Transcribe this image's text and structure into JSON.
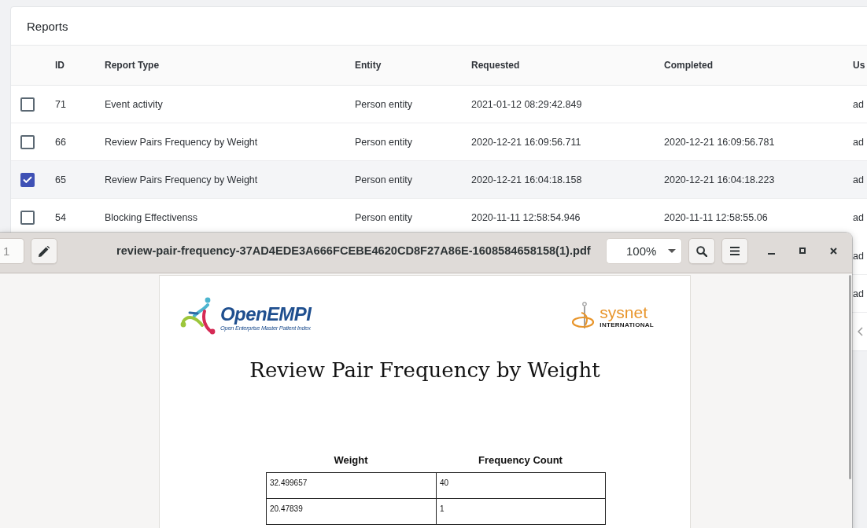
{
  "reports": {
    "title": "Reports",
    "columns": [
      "ID",
      "Report Type",
      "Entity",
      "Requested",
      "Completed",
      "Us"
    ],
    "rows": [
      {
        "selected": false,
        "id": "71",
        "report_type": "Event activity",
        "entity": "Person entity",
        "requested": "2021-01-12 08:29:42.849",
        "user": "ad"
      },
      {
        "selected": false,
        "id": "66",
        "report_type": "Review Pairs Frequency by Weight",
        "entity": "Person entity",
        "requested": "2020-12-21 16:09:56.711",
        "completed": "2020-12-21 16:09:56.781",
        "user": "ad"
      },
      {
        "selected": true,
        "id": "65",
        "report_type": "Review Pairs Frequency by Weight",
        "entity": "Person entity",
        "requested": "2020-12-21 16:04:18.158",
        "completed": "2020-12-21 16:04:18.223",
        "user": "ad"
      },
      {
        "selected": false,
        "id": "54",
        "report_type": "Blocking Effectivenss",
        "entity": "Person entity",
        "requested": "2020-11-11 12:58:54.946",
        "completed": "2020-11-11 12:58:55.06",
        "user": "ad"
      }
    ],
    "covered_rows": [
      {
        "user": "ad"
      },
      {
        "user": "ad"
      }
    ]
  },
  "pdf_viewer": {
    "page_number": "1",
    "file_name": "review-pair-frequency-37AD4EDE3A666FCEBE4620CD8F27A86E-1608584658158(1).pdf",
    "zoom": "100%",
    "document": {
      "logo_left": {
        "name": "OpenEMPI",
        "tagline": "Open Enterprise Master Patient Index"
      },
      "logo_right": {
        "name": "sysnet",
        "tagline": "INTERNATIONAL"
      },
      "title": "Review Pair Frequency by Weight",
      "table": {
        "columns": [
          "Weight",
          "Frequency Count"
        ],
        "rows": [
          [
            "32.499657",
            "40"
          ],
          [
            "20.47839",
            "1"
          ]
        ]
      }
    }
  }
}
